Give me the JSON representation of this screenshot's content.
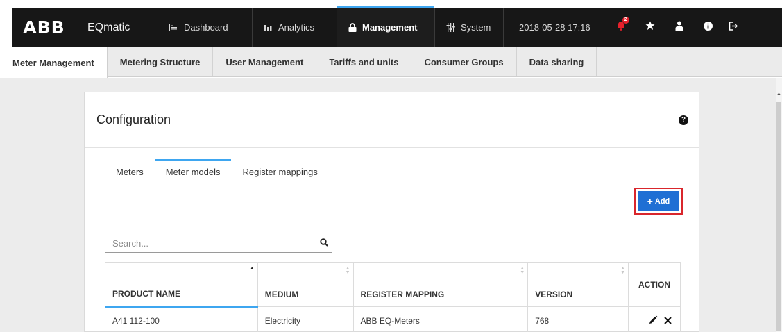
{
  "topbar": {
    "logo": "ABB",
    "app_name": "EQmatic",
    "tabs": [
      {
        "label": "Dashboard",
        "icon": "dashboard-icon"
      },
      {
        "label": "Analytics",
        "icon": "bar-chart-icon"
      },
      {
        "label": "Management",
        "icon": "lock-icon"
      },
      {
        "label": "System",
        "icon": "sliders-icon"
      }
    ],
    "datetime": "2018-05-28 17:16",
    "notification_count": "2",
    "accent_color": "#3ea6f0"
  },
  "subtabs": [
    "Meter Management",
    "Metering Structure",
    "User Management",
    "Tariffs and units",
    "Consumer Groups",
    "Data sharing"
  ],
  "card": {
    "title": "Configuration",
    "help_icon": "?",
    "inner_tabs": [
      "Meters",
      "Meter models",
      "Register mappings"
    ],
    "add_button": "Add",
    "add_button_color": "#1f6fd4",
    "search_placeholder": "Search...",
    "table": {
      "columns": [
        "PRODUCT NAME",
        "MEDIUM",
        "REGISTER MAPPING",
        "VERSION",
        "ACTION"
      ],
      "rows": [
        {
          "product_name": "A41 112-100",
          "medium": "Electricity",
          "register_mapping": "ABB EQ-Meters",
          "version": "768"
        }
      ]
    }
  }
}
